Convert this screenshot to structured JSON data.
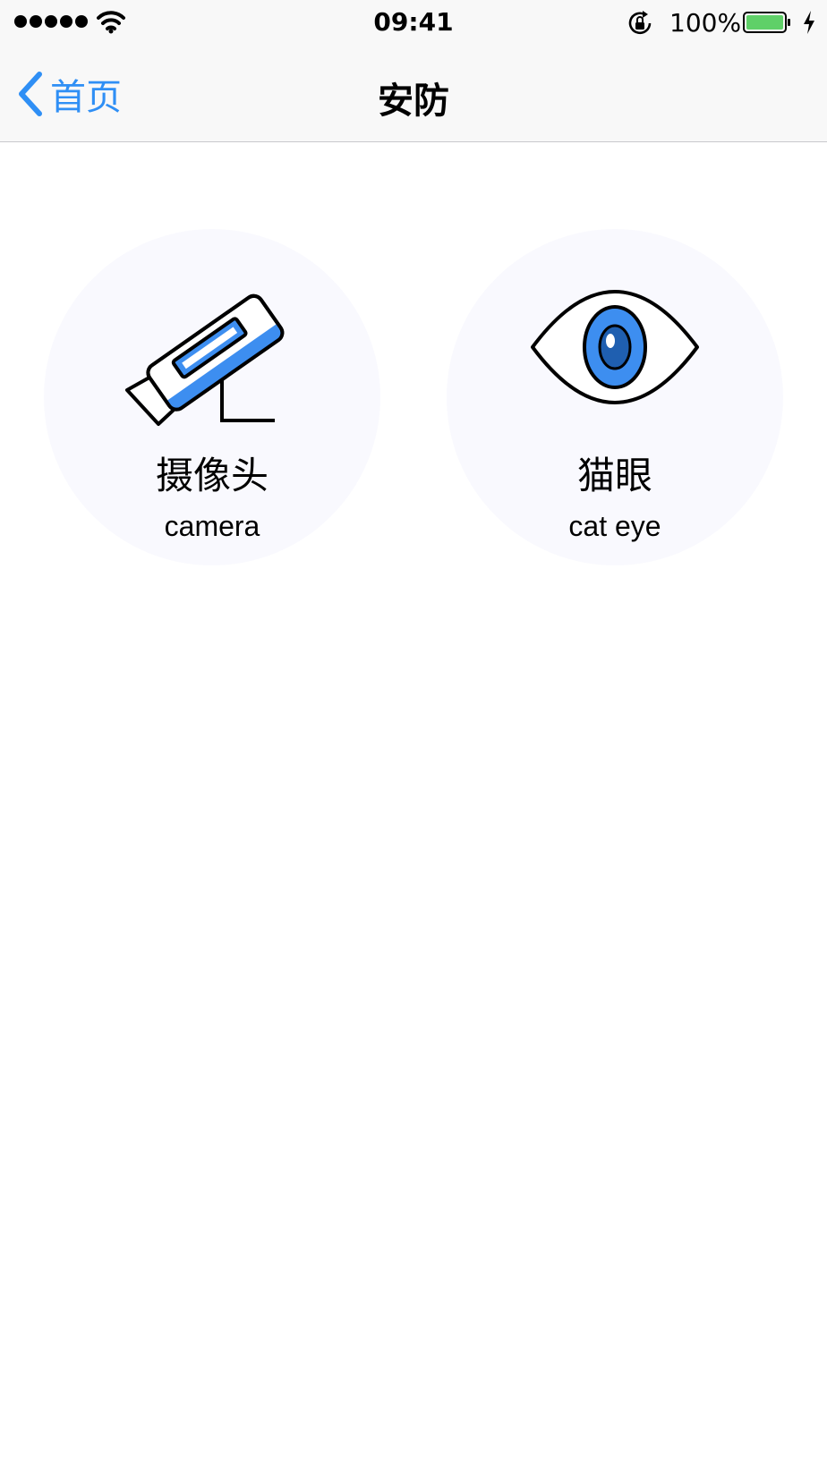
{
  "status_bar": {
    "time": "09:41",
    "battery_percent": "100%",
    "signal_bars": 5,
    "icons": [
      "signal-dots-icon",
      "wifi-icon",
      "rotation-lock-icon",
      "battery-icon",
      "charging-icon"
    ],
    "battery_color": "#5fd068"
  },
  "nav": {
    "back_label": "首页",
    "title": "安防",
    "accent_color": "#2f8ff5"
  },
  "devices": [
    {
      "icon": "security-camera-icon",
      "title": "摄像头",
      "subtitle": "camera"
    },
    {
      "icon": "eye-icon",
      "title": "猫眼",
      "subtitle": "cat eye"
    }
  ],
  "colors": {
    "tile_background": "#f9f9fe",
    "icon_blue": "#3d8ef0",
    "icon_dark_blue": "#1f5fb0"
  }
}
